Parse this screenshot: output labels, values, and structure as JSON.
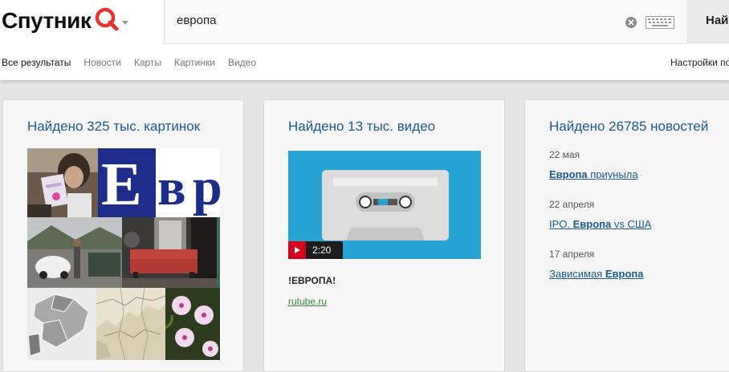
{
  "header": {
    "logo_text": "Спутник",
    "search_value": "европа",
    "search_button": "Найти",
    "nav": [
      {
        "label": "Все результаты",
        "active": true
      },
      {
        "label": "Новости"
      },
      {
        "label": "Карты"
      },
      {
        "label": "Картинки"
      },
      {
        "label": "Видео"
      }
    ],
    "settings_label": "Настройки поиска"
  },
  "images_card": {
    "title": "Найдено 325 тыс. картинок"
  },
  "video_card": {
    "title": "Найдено 13 тыс. видео",
    "duration": "2:20",
    "video_title": "!ЕВРОПА!",
    "source": "rutube.ru"
  },
  "news_card": {
    "title": "Найдено 26785 новостей",
    "items": [
      {
        "date": "22 мая",
        "prefix": "",
        "bold": "Европа",
        "suffix": " приуныла"
      },
      {
        "date": "22 апреля",
        "prefix": "IPO. ",
        "bold": "Европа",
        "suffix": " vs США"
      },
      {
        "date": "17 апреля",
        "prefix": "Зависимая ",
        "bold": "Европа",
        "suffix": ""
      }
    ]
  },
  "colors": {
    "link_blue": "#1a5a96",
    "logo_red": "#e8322b",
    "video_bg": "#27a3d4",
    "play_red": "#d6001c",
    "source_green": "#3a8a3a"
  }
}
